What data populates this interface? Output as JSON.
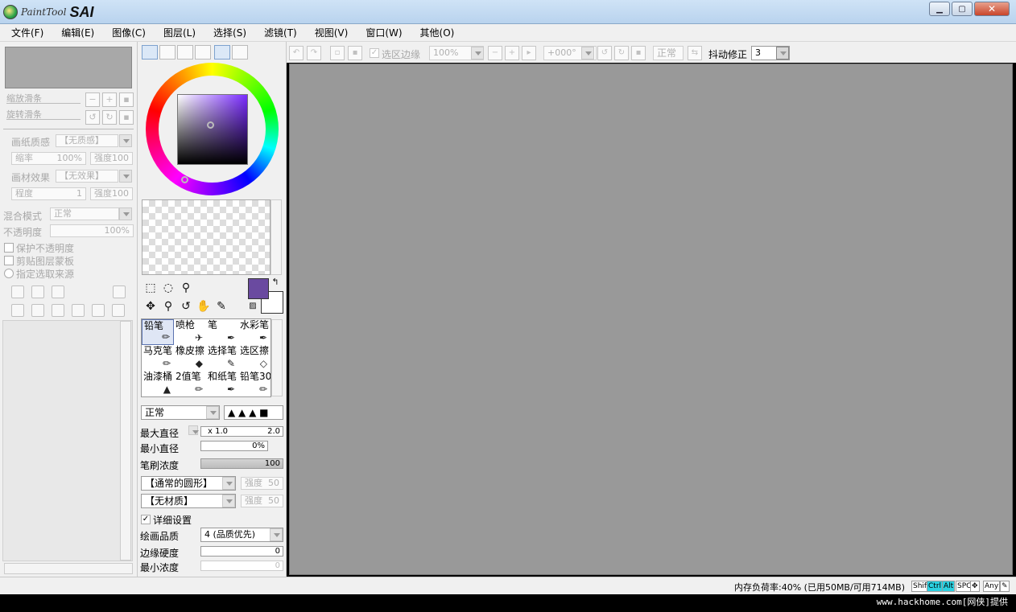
{
  "app": {
    "logo_small": "PaintTool",
    "logo_big": "SAI"
  },
  "window_controls": {
    "minimize": "▁",
    "maximize": "▢",
    "close": "✕"
  },
  "menu": [
    "文件(F)",
    "编辑(E)",
    "图像(C)",
    "图层(L)",
    "选择(S)",
    "滤镜(T)",
    "视图(V)",
    "窗口(W)",
    "其他(O)"
  ],
  "left": {
    "zoom_label": "缩放滑条",
    "rotate_label": "旋转滑条",
    "paper_label": "画纸质感",
    "paper_value": "【无质感】",
    "scale_label": "缩率",
    "scale_value": "100%",
    "strength_label": "强度",
    "strength_value": "100",
    "effect_label": "画材效果",
    "effect_value": "【无效果】",
    "degree_label": "程度",
    "degree_value": "1",
    "strength2_label": "强度",
    "strength2_value": "100",
    "blend_label": "混合模式",
    "blend_value": "正常",
    "opacity_label": "不透明度",
    "opacity_value": "100%",
    "protect_label": "保护不透明度",
    "clip_label": "剪贴图层蒙板",
    "source_label": "指定选取来源"
  },
  "color": {
    "tab_icons": [
      "color-wheel-icon",
      "rgb-slider-icon",
      "hsv-slider-icon",
      "swatch-icon",
      "palette-icon",
      "scratch-pad-icon"
    ],
    "fg": "#6a4aa0",
    "bg": "#ffffff"
  },
  "brushes": [
    {
      "name": "铅笔",
      "icon": "pencil-icon"
    },
    {
      "name": "喷枪",
      "icon": "airbrush-icon"
    },
    {
      "name": "笔",
      "icon": "brush-icon"
    },
    {
      "name": "水彩笔",
      "icon": "watercolor-icon"
    },
    {
      "name": "马克笔",
      "icon": "marker-icon"
    },
    {
      "name": "橡皮擦",
      "icon": "eraser-icon"
    },
    {
      "name": "选择笔",
      "icon": "select-pen-icon"
    },
    {
      "name": "选区擦",
      "icon": "select-eraser-icon"
    },
    {
      "name": "油漆桶",
      "icon": "bucket-icon"
    },
    {
      "name": "2值笔",
      "icon": "binary-pen-icon"
    },
    {
      "name": "和纸笔",
      "icon": "washi-pen-icon"
    },
    {
      "name": "铅笔30",
      "icon": "pencil30-icon"
    }
  ],
  "brush_settings": {
    "mode": "正常",
    "max_size_label": "最大直径",
    "max_size_mult": "x 1.0",
    "max_size_value": "2.0",
    "min_size_label": "最小直径",
    "min_size_value": "0%",
    "density_label": "笔刷浓度",
    "density_value": "100",
    "shape": "【通常的圆形】",
    "shape_strength_label": "强度",
    "shape_strength_value": "50",
    "texture": "【无材质】",
    "texture_strength_label": "强度",
    "texture_strength_value": "50",
    "detail_label": "详细设置",
    "quality_label": "绘画品质",
    "quality_value": "4 (品质优先)",
    "edge_label": "边缘硬度",
    "edge_value": "0",
    "min_density_label": "最小浓度",
    "min_density_value": "0"
  },
  "canvas_toolbar": {
    "selection_edge_label": "选区边缘",
    "zoom_value": "100%",
    "angle_value": "+000°",
    "blend_value": "正常",
    "stabilizer_label": "抖动修正",
    "stabilizer_value": "3"
  },
  "status": {
    "memory": "内存负荷率:40% (已用50MB/可用714MB)",
    "keys": [
      {
        "label": "Shift",
        "on": false
      },
      {
        "label": "Ctrl",
        "on": true
      },
      {
        "label": "Alt",
        "on": true
      },
      {
        "label": "SPC",
        "on": false
      },
      {
        "label": "Any",
        "on": false
      }
    ]
  },
  "footer": {
    "credit": "www.hackhome.com[网侠]提供"
  }
}
